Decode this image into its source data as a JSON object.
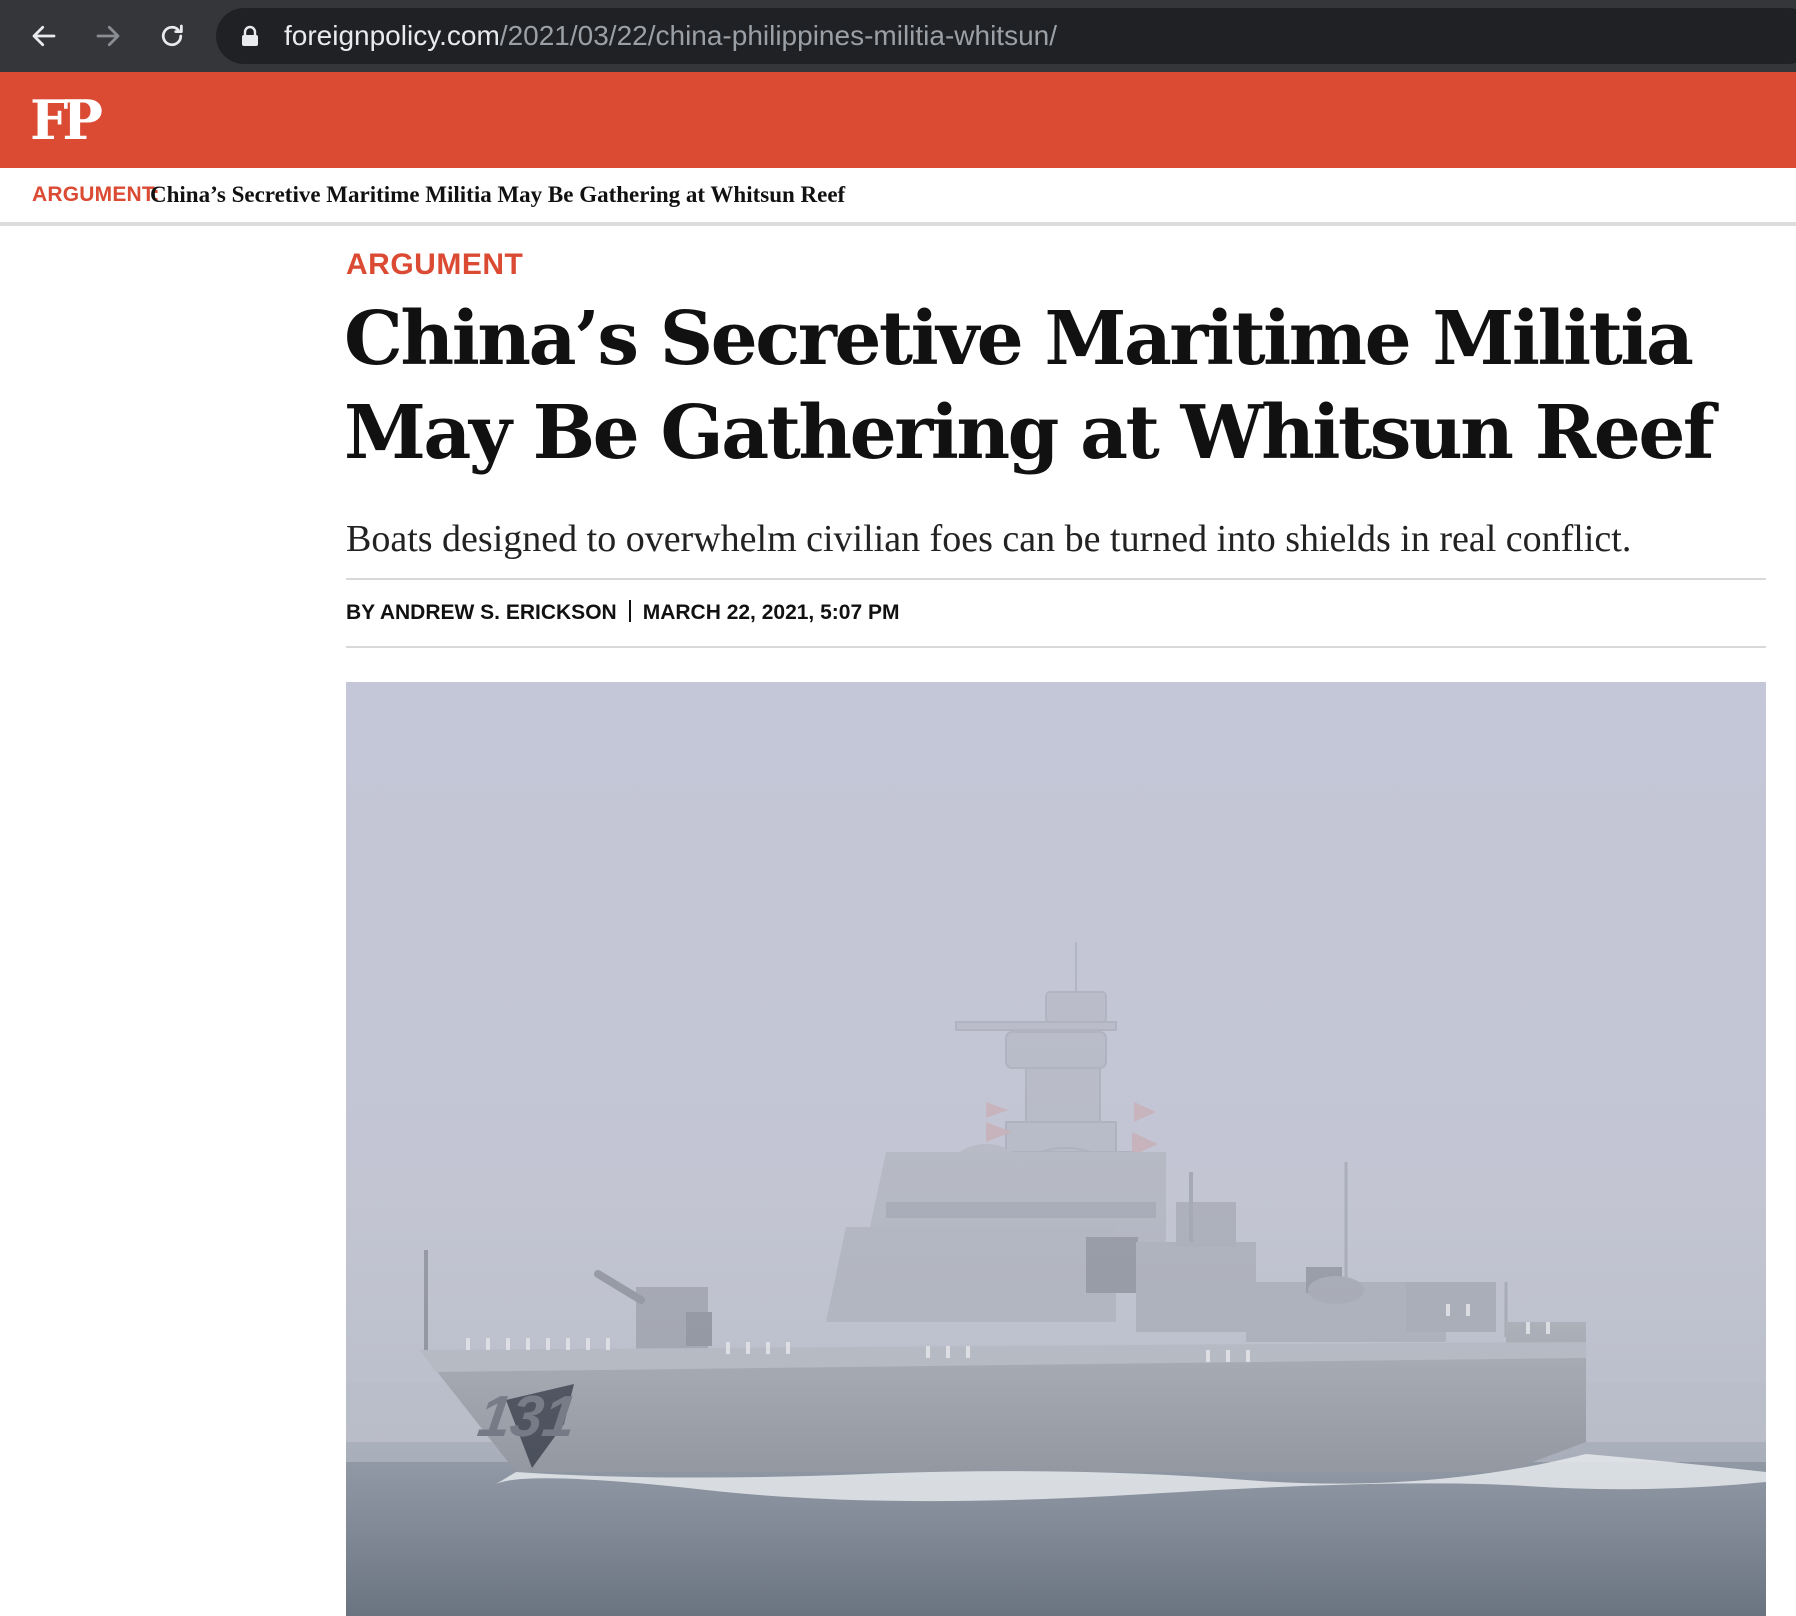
{
  "browser": {
    "url_host": "foreignpolicy.com",
    "url_path": "/2021/03/22/china-philippines-militia-whitsun/"
  },
  "site": {
    "logo": "FP",
    "brand_color": "#db4a33"
  },
  "sticky_header": {
    "kicker": "ARGUMENT:",
    "title": "China’s Secretive Maritime Militia May Be Gathering at Whitsun Reef"
  },
  "article": {
    "kicker": "ARGUMENT",
    "headline": "China’s Secretive Maritime Militia May Be Gathering at Whitsun Reef",
    "dek": "Boats designed to overwhelm civilian foes can be turned into shields in real conflict.",
    "byline": "BY ANDREW S. ERICKSON",
    "date": "MARCH 22, 2021, 5:07 PM",
    "hero_image": {
      "hull_number": "131"
    }
  },
  "icons": [
    "back-arrow-icon",
    "forward-arrow-icon",
    "reload-icon",
    "lock-icon"
  ]
}
